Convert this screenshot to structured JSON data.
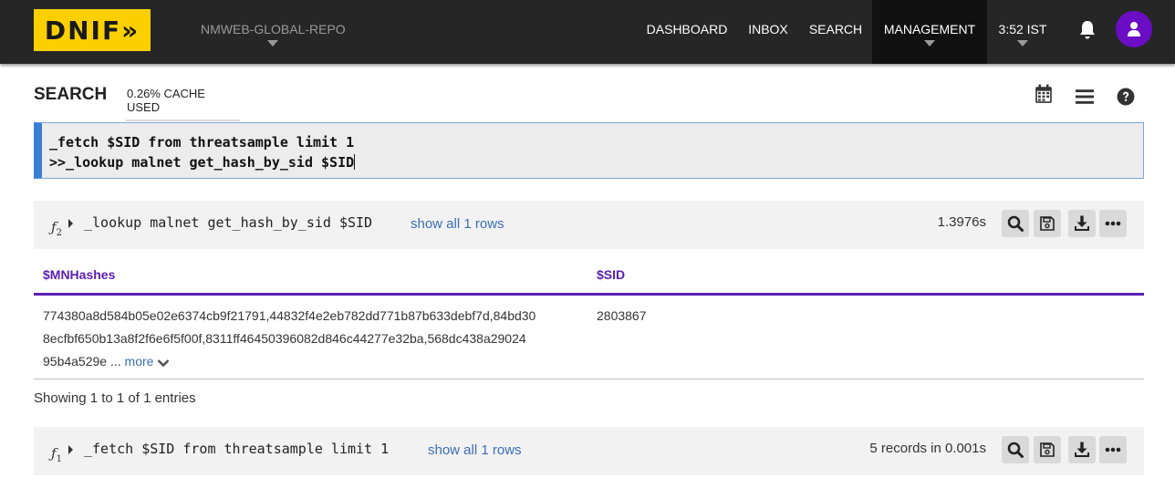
{
  "topbar": {
    "logo_text": "DNIF»",
    "repo": "NMWEB-GLOBAL-REPO",
    "nav": [
      "DASHBOARD",
      "INBOX",
      "SEARCH",
      "MANAGEMENT"
    ],
    "time": "3:52 IST",
    "avatar_color": "#6a0dc5"
  },
  "search": {
    "title": "SEARCH",
    "cache": "0.26% CACHE USED",
    "icons": [
      "calendar-icon",
      "list-icon",
      "help-icon"
    ]
  },
  "query": {
    "line1": "_fetch $SID from threatsample limit 1",
    "line2": ">>_lookup malnet get_hash_by_sid $SID"
  },
  "results": [
    {
      "fn_label": "ƒ",
      "fn_index": "2",
      "command": "_lookup malnet get_hash_by_sid $SID",
      "show_all": "show all 1 rows",
      "timing": "1.3976s"
    },
    {
      "fn_label": "ƒ",
      "fn_index": "1",
      "command": "_fetch $SID from threatsample limit 1",
      "show_all": "show all 1 rows",
      "timing": "5 records in 0.001s"
    }
  ],
  "table": {
    "columns": [
      "$MNHashes",
      "$SID"
    ],
    "row": {
      "hash_line1": "774380a8d584b05e02e6374cb9f21791,44832f4e2eb782dd771b87b633debf7d,84bd30",
      "hash_line2": "8ecfbf650b13a8f2f6e6f5f00f,8311ff46450396082d846c44277e32ba,568dc438a29024",
      "hash_line3": "95b4a529e",
      "ellipsis": " ... ",
      "more": "more",
      "sid": "2803867"
    },
    "footer": "Showing 1 to 1 of 1 entries"
  },
  "colors": {
    "accent": "#5b1fb3",
    "logo": "#fcd000",
    "link": "#3a6fb5"
  }
}
